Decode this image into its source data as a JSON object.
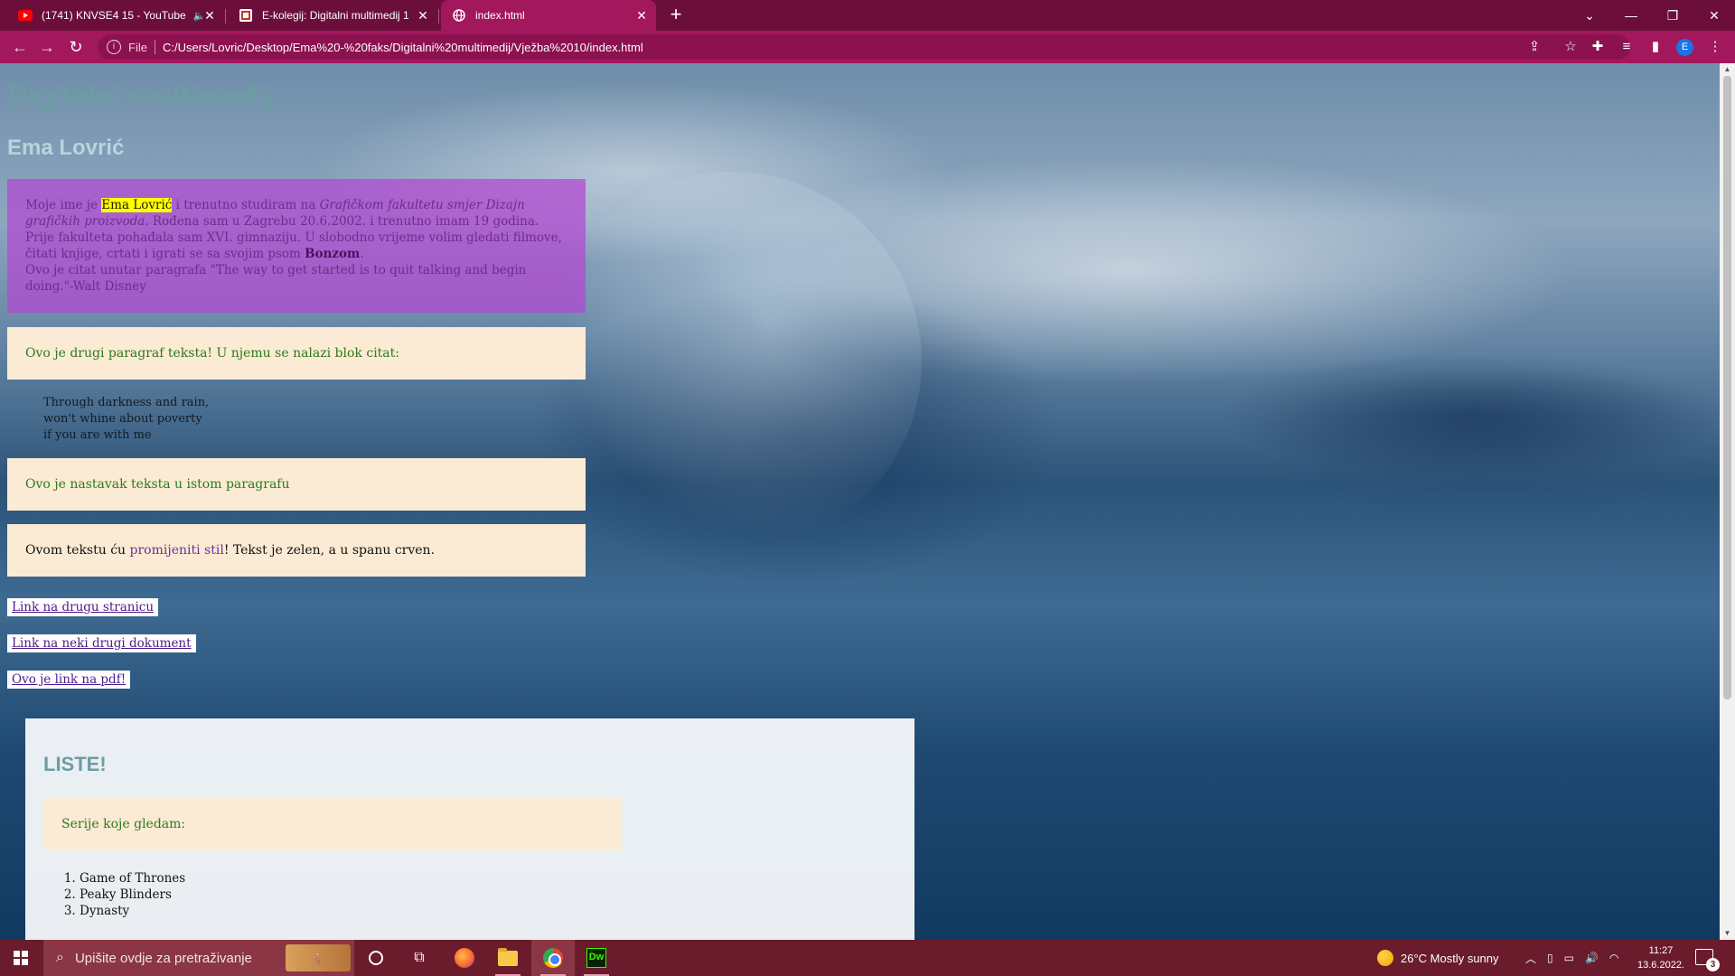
{
  "browser": {
    "tabs": [
      {
        "title": "(1741) KNVSE4 15 - YouTube",
        "favicon": "youtube-icon",
        "audio": "speaker-icon",
        "active": false
      },
      {
        "title": "E-kolegij: Digitalni multimedij 1",
        "favicon": "ekolegij-icon",
        "active": false
      },
      {
        "title": "index.html",
        "favicon": "globe-icon",
        "active": true
      }
    ],
    "new_tab": "+",
    "address": {
      "scheme": "File",
      "url": "C:/Users/Lovric/Desktop/Ema%20-%20faks/Digitalni%20multimedij/Vježba%2010/index.html"
    },
    "profile_initial": "E",
    "theme_color": "#a3175d"
  },
  "page": {
    "h1": "Digitalni multimedij",
    "h2": "Ema Lovrić",
    "intro": {
      "t1": "Moje ime je ",
      "name": "Ema Lovrić",
      "t2": " i trenutno studiram na ",
      "faculty": "Grafičkom fakultetu smjer Dizajn grafičkih proizvoda",
      "t3": ". Rođena sam u Zagrebu 20.6.2002. i trenutno imam 19 godina. Prije fakulteta pohađala sam XVI. gimnaziju. U slobodno vrijeme volim gledati filmove, čitati knjige, crtati i igrati se sa svojim psom ",
      "dog": "Bonzom",
      "t4": ".",
      "quote_line": "Ovo je citat unutar paragrafa \"The way to get started is to quit talking and begin doing.\"-Walt Disney"
    },
    "p2": "Ovo je drugi paragraf teksta! U njemu se nalazi blok citat:",
    "blockquote": [
      "Through darkness and rain,",
      "won't whine about poverty",
      "if you are with me"
    ],
    "p3": "Ovo je nastavak teksta u istom paragrafu",
    "p4": {
      "t1": "Ovom tekstu ću ",
      "span": "promijeniti stil",
      "t2": "! Tekst je zelen, a u spanu crven."
    },
    "links": [
      "Link na drugu stranicu",
      "Link na neki drugi dokument",
      "Ovo je link na pdf!"
    ],
    "lists": {
      "title": "LISTE!",
      "para": "Serije koje gledam:",
      "items": [
        "Game of Thrones",
        "Peaky Blinders",
        "Dynasty"
      ]
    }
  },
  "taskbar": {
    "search_placeholder": "Upišite ovdje za pretraživanje",
    "weather": "26°C  Mostly sunny",
    "time": "11:27",
    "date": "13.6.2022.",
    "notification_count": "3"
  }
}
